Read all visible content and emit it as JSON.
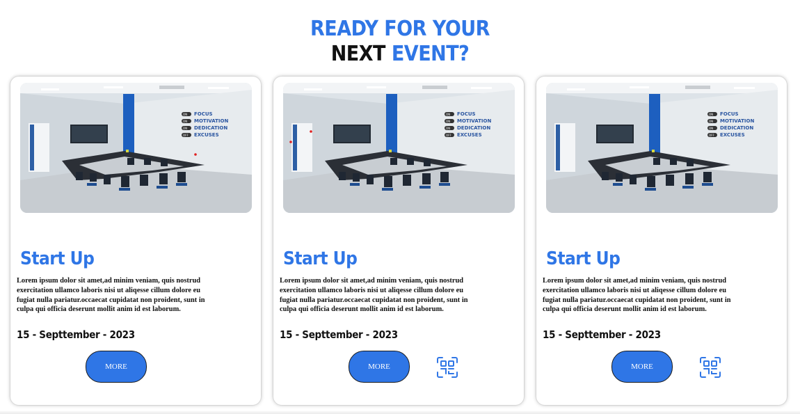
{
  "heading": {
    "line1": "READY FOR YOUR",
    "line2_dark": "NEXT",
    "line2_blue": "EVENT?"
  },
  "cards": [
    {
      "title": "Start Up",
      "description": "Lorem ipsum dolor sit amet,ad minim veniam, quis nostrud exercitation ullamco laboris nisi ut aliqesse cillum dolore eu fugiat nulla pariatur.occaecat cupidatat non proident, sunt in culpa qui officia deserunt mollit anim id est laborum.",
      "date": "15 - Septtember - 2023",
      "button_label": "MORE",
      "photo_wall_text": [
        "FOCUS",
        "MOTIVATION",
        "DEDICATION",
        "EXCUSES"
      ],
      "photo_wall_toggles": [
        "ON",
        "ON",
        "ON",
        "OFF"
      ]
    },
    {
      "title": "Start Up",
      "description": "Lorem ipsum dolor sit amet,ad minim veniam, quis nostrud exercitation ullamco laboris nisi ut aliqesse cillum dolore eu fugiat nulla pariatur.occaecat cupidatat non proident, sunt in culpa qui officia deserunt mollit anim id est laborum.",
      "date": "15 - Septtember - 2023",
      "button_label": "MORE",
      "qr_icon": "qr-scan-icon",
      "photo_wall_text": [
        "FOCUS",
        "MOTIVATION",
        "DEDICATION",
        "EXCUSES"
      ],
      "photo_wall_toggles": [
        "ON",
        "ON",
        "ON",
        "OFF"
      ]
    },
    {
      "title": "Start Up",
      "description": "Lorem ipsum dolor sit amet,ad minim veniam, quis nostrud exercitation ullamco laboris nisi ut aliqesse cillum dolore eu fugiat nulla pariatur.occaecat cupidatat non proident, sunt in culpa qui officia deserunt mollit anim id est laborum.",
      "date": "15 - Septtember - 2023",
      "button_label": "MORE",
      "qr_icon": "qr-scan-icon",
      "photo_wall_text": [
        "FOCUS",
        "MOTIVATION",
        "DEDICATION",
        "EXCUSES"
      ],
      "photo_wall_toggles": [
        "ON",
        "ON",
        "ON",
        "OFF"
      ]
    }
  ],
  "colors": {
    "accent": "#2f76e6",
    "text": "#111111",
    "background": "#ffffff"
  }
}
